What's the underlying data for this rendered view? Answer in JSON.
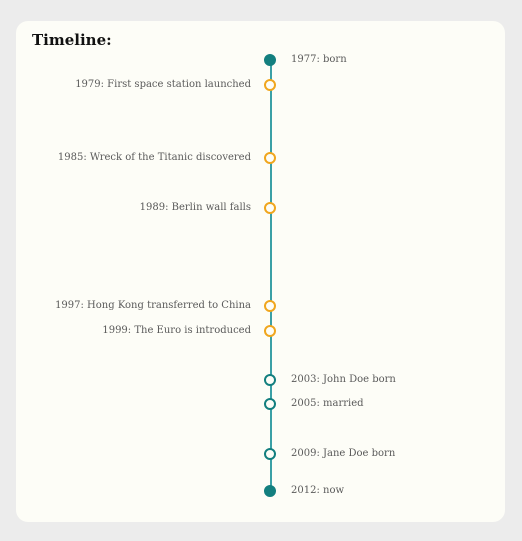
{
  "title": "Timeline:",
  "colors": {
    "line": "#3aa0a6",
    "world_event": "#f0a61e",
    "personal_event": "#137f7f",
    "card_bg": "#fdfdf7",
    "page_bg": "#ececec"
  },
  "events": [
    {
      "year": 1977,
      "text": "1977: born",
      "side": "right",
      "kind": "personal",
      "filled": true
    },
    {
      "year": 1979,
      "text": "1979: First space station launched",
      "side": "left",
      "kind": "world",
      "filled": false
    },
    {
      "year": 1985,
      "text": "1985: Wreck of the Titanic discovered",
      "side": "left",
      "kind": "world",
      "filled": false
    },
    {
      "year": 1989,
      "text": "1989: Berlin wall falls",
      "side": "left",
      "kind": "world",
      "filled": false
    },
    {
      "year": 1997,
      "text": "1997: Hong Kong transferred to China",
      "side": "left",
      "kind": "world",
      "filled": false
    },
    {
      "year": 1999,
      "text": "1999: The Euro is introduced",
      "side": "left",
      "kind": "world",
      "filled": false
    },
    {
      "year": 2003,
      "text": "2003: John Doe born",
      "side": "right",
      "kind": "personal",
      "filled": false
    },
    {
      "year": 2005,
      "text": "2005: married",
      "side": "right",
      "kind": "personal",
      "filled": false
    },
    {
      "year": 2009,
      "text": "2009: Jane Doe born",
      "side": "right",
      "kind": "personal",
      "filled": false
    },
    {
      "year": 2012,
      "text": "2012: now",
      "side": "right",
      "kind": "personal",
      "filled": true
    }
  ]
}
